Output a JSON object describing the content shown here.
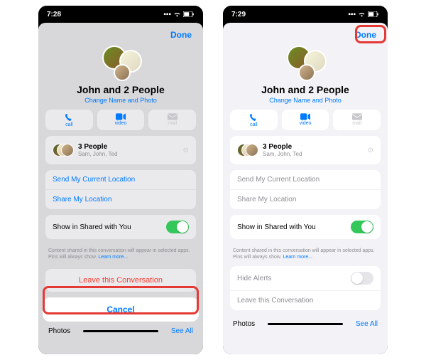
{
  "left": {
    "status": {
      "time": "7:28",
      "loc": "◤"
    },
    "done": "Done",
    "title": "John and 2 People",
    "subtitle": "Change Name and Photo",
    "actions": {
      "call": "call",
      "video": "video",
      "mail": "mail"
    },
    "people": {
      "count": "3 People",
      "names": "Sam, John, Ted"
    },
    "location1": "Send My Current Location",
    "location2": "Share My Location",
    "shared": "Show in Shared with You",
    "note": "Content shared in this conversation will appear in selected apps. Pins will always show.",
    "learn": "Learn more...",
    "leave": "Leave this Conversation",
    "cancel": "Cancel",
    "photos": "Photos",
    "seeall": "See All"
  },
  "right": {
    "status": {
      "time": "7:29",
      "loc": "◤"
    },
    "done": "Done",
    "title": "John and 2 People",
    "subtitle": "Change Name and Photo",
    "actions": {
      "call": "call",
      "video": "video",
      "mail": "mail"
    },
    "people": {
      "count": "3 People",
      "names": "Sam, John, Ted"
    },
    "location1": "Send My Current Location",
    "location2": "Share My Location",
    "shared": "Show in Shared with You",
    "note": "Content shared in this conversation will appear in selected apps. Pins will always show.",
    "learn": "Learn more...",
    "hide": "Hide Alerts",
    "leave": "Leave this Conversation",
    "photos": "Photos",
    "seeall": "See All"
  }
}
